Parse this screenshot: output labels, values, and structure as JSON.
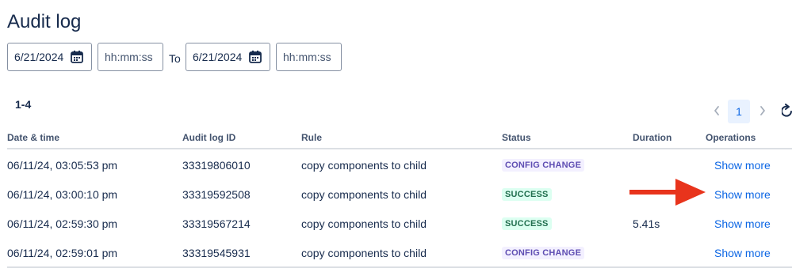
{
  "page": {
    "title": "Audit log"
  },
  "filters": {
    "from_date": "6/21/2024",
    "from_time_placeholder": "hh:mm:ss",
    "to_label": "To",
    "to_date": "6/21/2024",
    "to_time_placeholder": "hh:mm:ss"
  },
  "results": {
    "range": "1-4"
  },
  "pagination": {
    "current_page": "1"
  },
  "table": {
    "columns": [
      "Date & time",
      "Audit log ID",
      "Rule",
      "Status",
      "Duration",
      "Operations"
    ],
    "rows": [
      {
        "datetime": "06/11/24, 03:05:53 pm",
        "id": "33319806010",
        "rule": "copy components to child",
        "status": "CONFIG CHANGE",
        "status_type": "config",
        "duration": "",
        "operation": "Show more"
      },
      {
        "datetime": "06/11/24, 03:00:10 pm",
        "id": "33319592508",
        "rule": "copy components to child",
        "status": "SUCCESS",
        "status_type": "success",
        "duration": "",
        "operation": "Show more"
      },
      {
        "datetime": "06/11/24, 02:59:30 pm",
        "id": "33319567214",
        "rule": "copy components to child",
        "status": "SUCCESS",
        "status_type": "success",
        "duration": "5.41s",
        "operation": "Show more"
      },
      {
        "datetime": "06/11/24, 02:59:01 pm",
        "id": "33319545931",
        "rule": "copy components to child",
        "status": "CONFIG CHANGE",
        "status_type": "config",
        "duration": "",
        "operation": "Show more"
      }
    ]
  },
  "annotation": {
    "arrow_color": "#e8341c"
  },
  "colors": {
    "link": "#0c66e4",
    "text": "#172b4d",
    "subtle": "#44546f"
  }
}
